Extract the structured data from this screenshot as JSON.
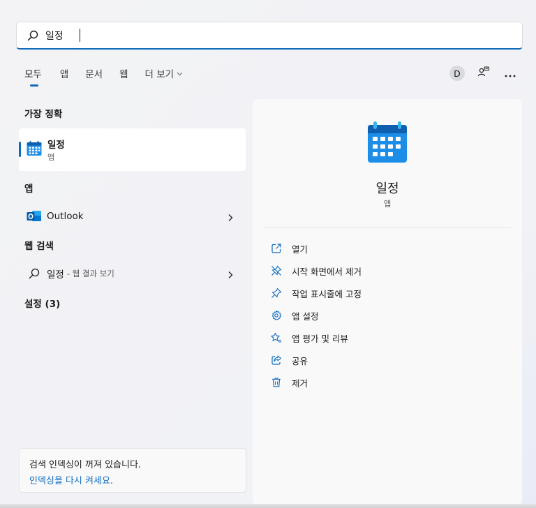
{
  "search": {
    "value": "일정",
    "placeholder": ""
  },
  "tabs": [
    {
      "label": "모두"
    },
    {
      "label": "앱"
    },
    {
      "label": "문서"
    },
    {
      "label": "웹"
    },
    {
      "label": "더 보기"
    }
  ],
  "account": {
    "initial": "D"
  },
  "left": {
    "best_match_title": "가장 정확",
    "best_match": {
      "name": "일정",
      "type": "앱"
    },
    "apps_title": "앱",
    "apps": [
      {
        "name": "Outlook"
      }
    ],
    "web_title": "웹 검색",
    "web_query": "일정",
    "web_suffix": "- 웹 결과 보기",
    "settings_title": "설정 (3)"
  },
  "index_notice": {
    "message": "검색 인덱싱이 꺼져 있습니다.",
    "link": "인덱싱을 다시 켜세요."
  },
  "detail": {
    "title": "일정",
    "subtitle": "앱",
    "actions": [
      {
        "label": "열기",
        "icon": "open-external-icon"
      },
      {
        "label": "시작 화면에서 제거",
        "icon": "unpin-icon"
      },
      {
        "label": "작업 표시줄에 고정",
        "icon": "pin-icon"
      },
      {
        "label": "앱 설정",
        "icon": "gear-icon"
      },
      {
        "label": "앱 평가 및 리뷰",
        "icon": "star-review-icon"
      },
      {
        "label": "공유",
        "icon": "share-icon"
      },
      {
        "label": "제거",
        "icon": "trash-icon"
      }
    ]
  },
  "colors": {
    "accent": "#0f6cbd",
    "calendar": "#1d8ee8"
  }
}
